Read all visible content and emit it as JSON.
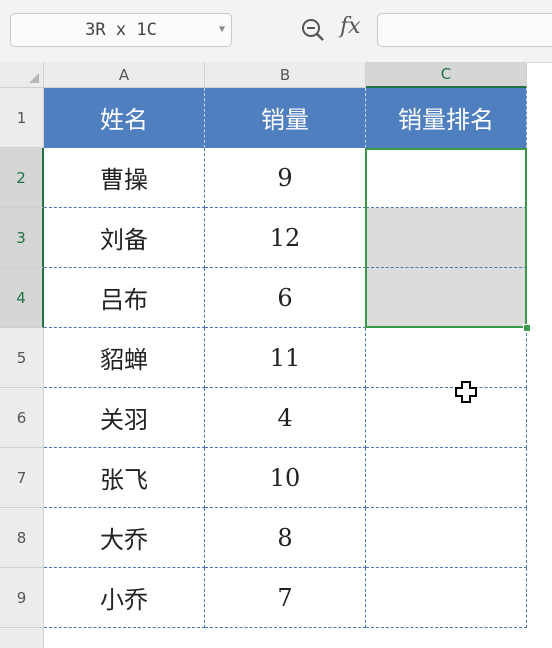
{
  "formula_bar": {
    "namebox_value": "3R x 1C",
    "zoom_icon": "zoom-out-icon",
    "fx_label": "fx",
    "formula_value": ""
  },
  "columns": [
    {
      "label": "A",
      "selected": false
    },
    {
      "label": "B",
      "selected": false
    },
    {
      "label": "C",
      "selected": true
    }
  ],
  "rows": [
    {
      "label": "1",
      "selected": false
    },
    {
      "label": "2",
      "selected": true
    },
    {
      "label": "3",
      "selected": true
    },
    {
      "label": "4",
      "selected": true
    },
    {
      "label": "5",
      "selected": false
    },
    {
      "label": "6",
      "selected": false
    },
    {
      "label": "7",
      "selected": false
    },
    {
      "label": "8",
      "selected": false
    },
    {
      "label": "9",
      "selected": false
    }
  ],
  "table": {
    "header": [
      "姓名",
      "销量",
      "销量排名"
    ],
    "rows": [
      [
        "曹操",
        "9",
        ""
      ],
      [
        "刘备",
        "12",
        ""
      ],
      [
        "吕布",
        "6",
        ""
      ],
      [
        "貂蝉",
        "11",
        ""
      ],
      [
        "关羽",
        "4",
        ""
      ],
      [
        "张飞",
        "10",
        ""
      ],
      [
        "大乔",
        "8",
        ""
      ],
      [
        "小乔",
        "7",
        ""
      ]
    ]
  },
  "colors": {
    "header_fill": "#4f7fbf",
    "selection_border": "#3a9a4a",
    "selected_header_text": "#217346"
  },
  "cursor_icon": "cell-cross-cursor-icon"
}
